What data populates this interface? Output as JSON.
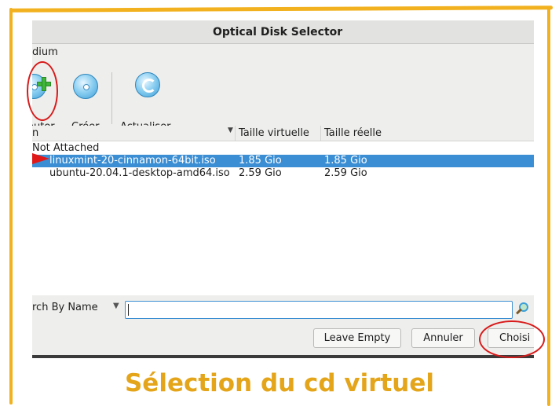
{
  "window": {
    "title": "Optical Disk Selector"
  },
  "menubar": {
    "items": [
      "dium"
    ]
  },
  "toolbar": {
    "add_label": "outer",
    "create_label": "Créer",
    "refresh_label": "Actualiser"
  },
  "table": {
    "columns": [
      "n",
      "Taille virtuelle",
      "Taille réelle"
    ],
    "group_label": "Not Attached",
    "rows": [
      {
        "name": "linuxmint-20-cinnamon-64bit.iso",
        "virtual_size": "1.85 Gio",
        "actual_size": "1.85 Gio",
        "selected": true
      },
      {
        "name": "ubuntu-20.04.1-desktop-amd64.iso",
        "virtual_size": "2.59 Gio",
        "actual_size": "2.59 Gio",
        "selected": false
      }
    ]
  },
  "search": {
    "mode": "rch By Name",
    "value": ""
  },
  "buttons": {
    "leave_empty": "Leave Empty",
    "cancel": "Annuler",
    "choose": "Choisi"
  },
  "caption": "Sélection du cd virtuel",
  "colors": {
    "selection": "#3b8ed3",
    "annotation": "#d81a1a",
    "caption": "#e4a51a",
    "frame": "#f2b21f"
  },
  "icons": [
    "add-disk-icon",
    "create-disk-icon",
    "refresh-disk-icon",
    "search-icon",
    "sort-arrow-icon",
    "dropdown-arrow-icon"
  ]
}
